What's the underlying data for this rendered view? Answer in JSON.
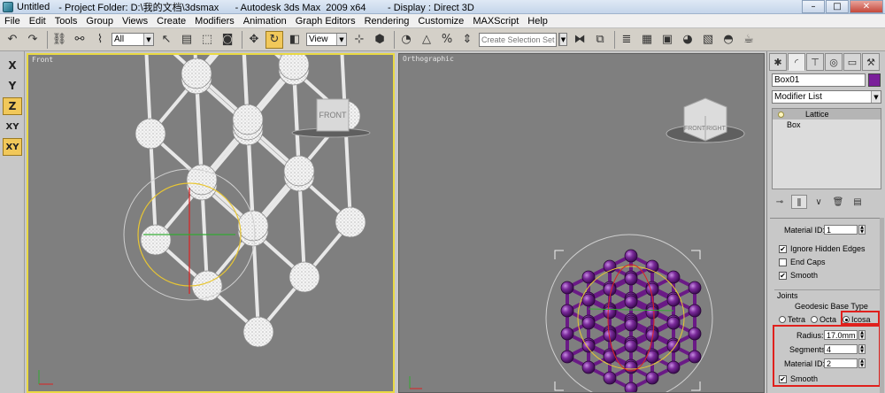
{
  "window": {
    "doc_title": "Untitled",
    "title_rest": "- Project Folder: D:\\我的文档\\3dsmax      - Autodesk 3ds Max  2009 x64        - Display : Direct 3D"
  },
  "menu": [
    "File",
    "Edit",
    "Tools",
    "Group",
    "Views",
    "Create",
    "Modifiers",
    "Animation",
    "Graph Editors",
    "Rendering",
    "Customize",
    "MAXScript",
    "Help"
  ],
  "toolbar": {
    "selection_filter": "All",
    "ref_coord": "View",
    "named_selection_placeholder": "Create Selection Set"
  },
  "axes": [
    "X",
    "Y",
    "Z",
    "XY",
    "XY"
  ],
  "viewports": {
    "front": {
      "label": "Front",
      "viewcube": "FRONT"
    },
    "ortho": {
      "label": "Orthographic",
      "viewcube_front": "FRONT",
      "viewcube_right": "RIGHT"
    }
  },
  "panel": {
    "object_name": "Box01",
    "object_color": "#7a1f9a",
    "modifier_list": "Modifier List",
    "stack": [
      "Lattice",
      "Box"
    ],
    "material_id_label_1": "Material ID:",
    "material_id_value_1": "1",
    "ignore_hidden_edges": "Ignore Hidden Edges",
    "end_caps": "End Caps",
    "smooth_1": "Smooth",
    "joints_group": "Joints",
    "geodesic_base_type": "Geodesic Base Type",
    "tetra": "Tetra",
    "octa": "Octa",
    "icosa": "Icosa",
    "radius_label": "Radius:",
    "radius_value": "17.0mm",
    "segments_label": "Segments:",
    "segments_value": "4",
    "material_id_label_2": "Material ID:",
    "material_id_value_2": "2",
    "smooth_2": "Smooth"
  },
  "colors": {
    "accent_active": "#f1c85a",
    "highlight_box": "#e0201c",
    "lattice_purple": "#6a1a86",
    "viewport_bg": "#7f7f7f"
  }
}
